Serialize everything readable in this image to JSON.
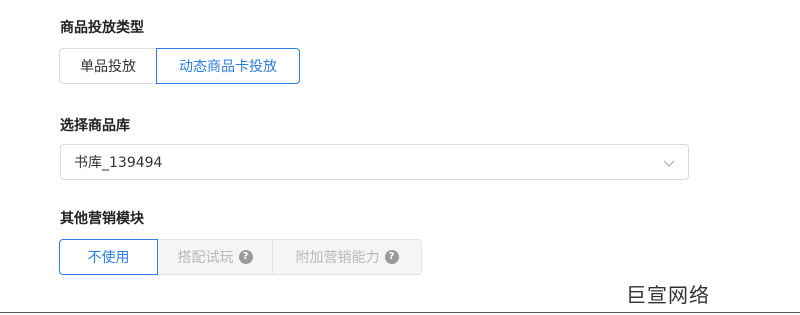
{
  "product_type": {
    "label": "商品投放类型",
    "options": [
      "单品投放",
      "动态商品卡投放"
    ],
    "selected": "动态商品卡投放"
  },
  "product_library": {
    "label": "选择商品库",
    "value": "书库_139494",
    "chevron_icon": "chevron-down-icon"
  },
  "marketing_module": {
    "label": "其他营销模块",
    "options": [
      "不使用",
      "搭配试玩",
      "附加营销能力"
    ],
    "selected": "不使用",
    "help_icon_glyph": "?"
  },
  "watermark": "巨宣网络",
  "colors": {
    "accent": "#2e7ee6",
    "border": "#d9d9d9",
    "disabled_bg": "#f5f5f5",
    "disabled_text": "#b8b8b8"
  }
}
